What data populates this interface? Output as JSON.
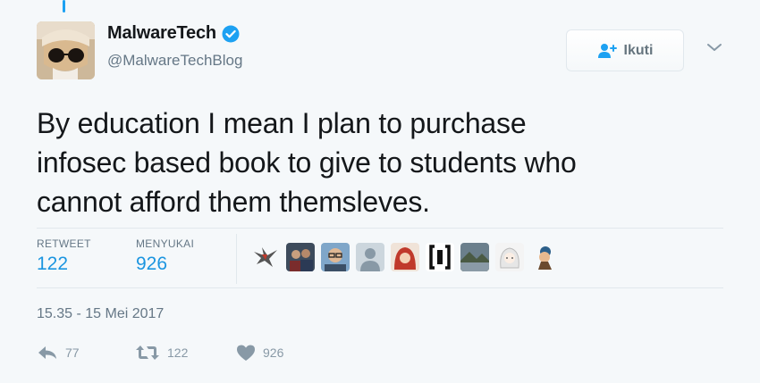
{
  "author": {
    "name": "MalwareTech",
    "handle": "@MalwareTechBlog",
    "verified": true,
    "avatar_icon": "profile-photo-sunglasses"
  },
  "follow_button": {
    "label": "Ikuti",
    "icon": "add-user-icon"
  },
  "tweet": {
    "lines": [
      "By education I mean I plan to purchase",
      "infosec based book to give to students who",
      "cannot afford them themsleves."
    ]
  },
  "stats": {
    "retweets_label": "RETWEET",
    "retweets_count": "122",
    "likes_label": "MENYUKAI",
    "likes_count": "926"
  },
  "likers": [
    {
      "icon": "liker-avatar-bird"
    },
    {
      "icon": "liker-avatar-group-photo"
    },
    {
      "icon": "liker-avatar-man-glasses"
    },
    {
      "icon": "liker-avatar-default"
    },
    {
      "icon": "liker-avatar-red-hood"
    },
    {
      "icon": "liker-avatar-braces-logo"
    },
    {
      "icon": "liker-avatar-landscape"
    },
    {
      "icon": "liker-avatar-anime"
    },
    {
      "icon": "liker-avatar-cartoon"
    }
  ],
  "timestamp": "15.35 - 15 Mei 2017",
  "actions": {
    "reply_count": "77",
    "retweet_count": "122",
    "like_count": "926"
  },
  "colors": {
    "background": "#f5f8fa",
    "link": "#1b95e0",
    "verified": "#1da1f2",
    "muted": "#657786"
  }
}
